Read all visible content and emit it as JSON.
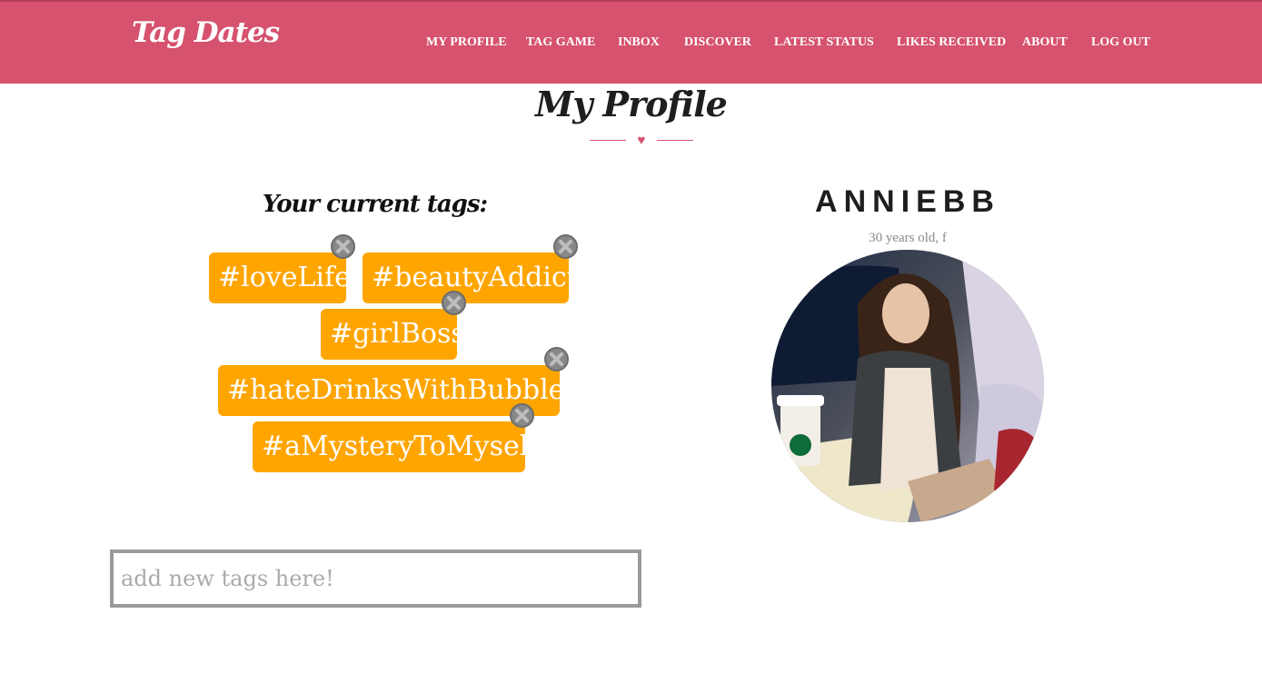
{
  "brand": {
    "name": "Tag Dates"
  },
  "nav": {
    "items": [
      "MY PROFILE",
      "TAG GAME",
      "INBOX",
      "DISCOVER",
      "LATEST STATUS",
      "LIKES RECEIVED",
      "ABOUT",
      "LOG OUT"
    ]
  },
  "page": {
    "title": "My Profile"
  },
  "tags": {
    "heading": "Your current tags:",
    "items": [
      "#loveLife",
      "#beautyAddict",
      "#girlBoss",
      "#hateDrinksWithBubbles",
      "#aMysteryToMyself"
    ],
    "input_placeholder": "add new tags here!",
    "input_value": ""
  },
  "profile": {
    "username": "ANNIEBB",
    "meta": "30 years old, f"
  },
  "icons": {
    "remove_tag": "close-circle-icon",
    "divider": "heart-icon"
  },
  "colors": {
    "nav_bg": "#d6526e",
    "tag_bg": "#ffa500",
    "remove_btn": "#888888",
    "accent": "#d6526e"
  }
}
